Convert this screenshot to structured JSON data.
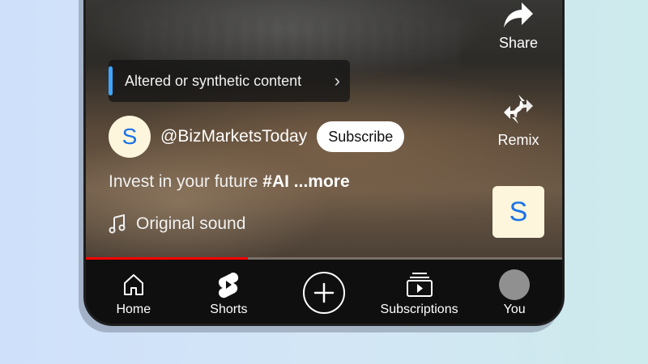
{
  "synthetic_notice": {
    "label": "Altered or synthetic content",
    "chevron": "›",
    "accent_color": "#3ea6ff"
  },
  "channel": {
    "avatar_letter": "S",
    "handle": "@BizMarketsToday",
    "subscribe_label": "Subscribe"
  },
  "description": {
    "text": "Invest in your future ",
    "hashtag": "#AI",
    "more": " ...more"
  },
  "sound": {
    "icon": "music-note-icon",
    "label": "Original sound"
  },
  "side_actions": {
    "share_label": "Share",
    "remix_label": "Remix",
    "sound_thumb_letter": "S"
  },
  "progress": {
    "fraction": 0.34,
    "color": "#ff0000"
  },
  "bottom_nav": {
    "home_label": "Home",
    "shorts_label": "Shorts",
    "create_icon": "plus-icon",
    "subscriptions_label": "Subscriptions",
    "you_label": "You"
  }
}
